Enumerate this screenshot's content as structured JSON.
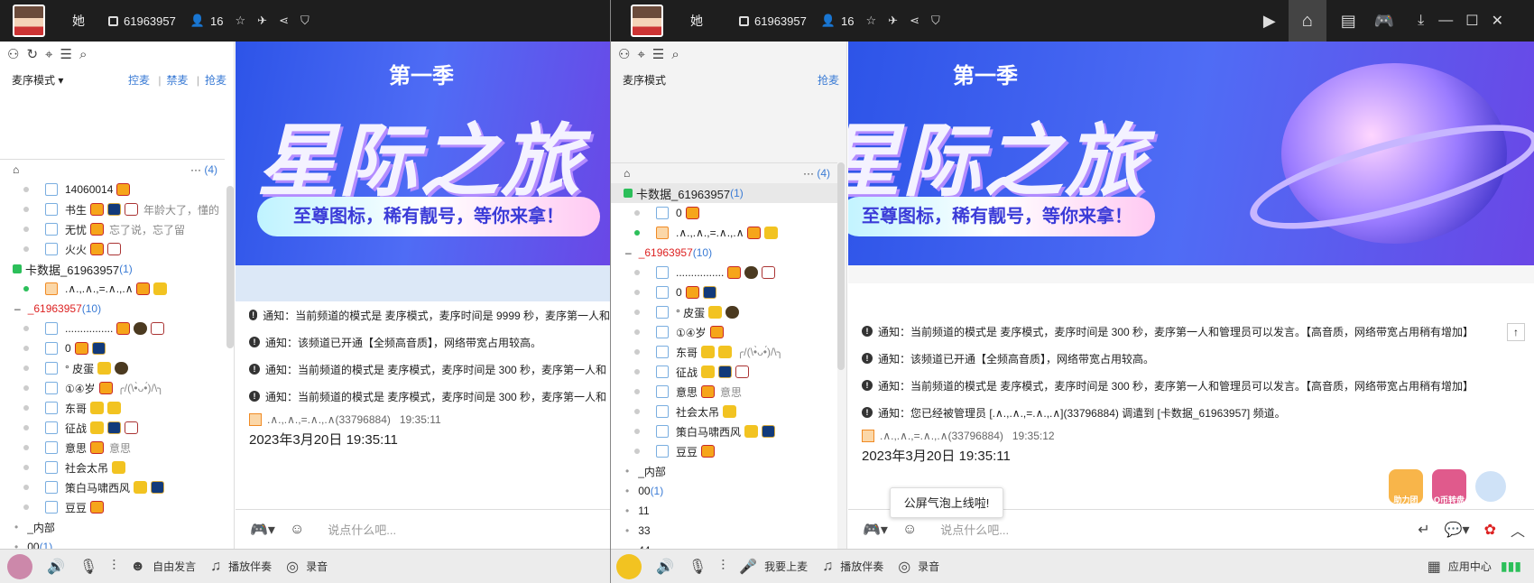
{
  "left": {
    "top": {
      "nick": "她",
      "id": "61963957",
      "count": "16"
    },
    "mode": "麦序模式",
    "mode_links": [
      "控麦",
      "禁麦",
      "抢麦"
    ],
    "ellipsis": "···",
    "count_suffix": "(4)",
    "tree": [
      {
        "kind": "user",
        "name": "14060014",
        "badges": [
          "crown"
        ]
      },
      {
        "kind": "user",
        "name": "书生",
        "badges": [
          "crown",
          "lol",
          "yz"
        ],
        "tail": "年龄大了，懂的"
      },
      {
        "kind": "user",
        "name": "无忧",
        "badges": [
          "crown"
        ],
        "tail": "忘了说，忘了留"
      },
      {
        "kind": "user",
        "name": "火火",
        "badges": [
          "crown",
          "yz"
        ]
      },
      {
        "kind": "channel",
        "name": "卡数据_61963957",
        "count": "(1)"
      },
      {
        "kind": "user",
        "online": true,
        "name": ".∧.,.∧.,=.∧.,.∧",
        "badges": [
          "crown",
          "gold"
        ],
        "orange": true
      },
      {
        "kind": "subchannel",
        "name": "_61963957",
        "count": "(10)"
      },
      {
        "kind": "user",
        "name": "................",
        "badges": [
          "crown",
          "w",
          "yz"
        ]
      },
      {
        "kind": "user",
        "name": "0",
        "badges": [
          "crown",
          "lol"
        ]
      },
      {
        "kind": "user",
        "name": "° 皮蛋",
        "badges": [
          "gold",
          "w"
        ]
      },
      {
        "kind": "user",
        "name": "①④岁",
        "badges": [
          "crown"
        ],
        "tail": "╭/(\\•̀ᴗ•́)/\\╮"
      },
      {
        "kind": "user",
        "name": "东哥",
        "badges": [
          "gold",
          "gold"
        ]
      },
      {
        "kind": "user",
        "name": "征战",
        "badges": [
          "gold",
          "lol",
          "yz"
        ]
      },
      {
        "kind": "user",
        "name": "意思",
        "badges": [
          "crown"
        ],
        "tail": "意思"
      },
      {
        "kind": "user",
        "name": "社会太吊",
        "badges": [
          "gold"
        ]
      },
      {
        "kind": "user",
        "name": "策白马啸西风",
        "badges": [
          "gold",
          "lol"
        ]
      },
      {
        "kind": "user",
        "name": "豆豆",
        "badges": [
          "crown"
        ]
      },
      {
        "kind": "folder",
        "name": "_内部"
      },
      {
        "kind": "folder",
        "name": "00",
        "count": "(1)"
      }
    ],
    "banner": {
      "season": "第一季",
      "title": "星际之旅",
      "sub": "至尊图标，稀有靓号，等你来拿！"
    },
    "messages": [
      "通知：当前频道的模式是 麦序模式，麦序时间是 9999 秒，麦序第一人和",
      "通知：该频道已开通【全频高音质】，网络带宽占用较高。",
      "通知：当前频道的模式是 麦序模式，麦序时间是 300 秒，麦序第一人和",
      "通知：当前频道的模式是 麦序模式，麦序时间是 300 秒，麦序第一人和"
    ],
    "sender": ".∧.,.∧.,=.∧.,.∧(33796884)",
    "sender_time": "19:35:11",
    "stamp": "2023年3月20日  19:35:11",
    "placeholder": "说点什么吧...",
    "bottom": [
      "自由发言",
      "播放伴奏",
      "录音"
    ]
  },
  "right": {
    "top": {
      "nick": "她",
      "id": "61963957",
      "count": "16"
    },
    "mode": "麦序模式",
    "mode_link": "抢麦",
    "ellipsis": "···",
    "count_suffix": "(4)",
    "tree": [
      {
        "kind": "channel",
        "name": "卡数据_61963957",
        "count": "(1)"
      },
      {
        "kind": "user",
        "name": "0",
        "badges": [
          "crown"
        ]
      },
      {
        "kind": "user",
        "online": true,
        "name": ".∧.,.∧.,=.∧.,.∧",
        "badges": [
          "crown",
          "gold"
        ],
        "orange": true
      },
      {
        "kind": "subchannel",
        "name": "_61963957",
        "count": "(10)"
      },
      {
        "kind": "user",
        "name": "................",
        "badges": [
          "crown",
          "w",
          "yz"
        ]
      },
      {
        "kind": "user",
        "name": "0",
        "badges": [
          "crown",
          "lol"
        ]
      },
      {
        "kind": "user",
        "name": "° 皮蛋",
        "badges": [
          "gold",
          "w"
        ]
      },
      {
        "kind": "user",
        "name": "①④岁",
        "badges": [
          "crown"
        ]
      },
      {
        "kind": "user",
        "name": "东哥",
        "badges": [
          "gold",
          "gold"
        ],
        "tail": "╭/(\\•̀ᴗ•́)/\\╮"
      },
      {
        "kind": "user",
        "name": "征战",
        "badges": [
          "gold",
          "lol",
          "yz"
        ]
      },
      {
        "kind": "user",
        "name": "意思",
        "badges": [
          "crown"
        ],
        "tail": "意思"
      },
      {
        "kind": "user",
        "name": "社会太吊",
        "badges": [
          "gold"
        ]
      },
      {
        "kind": "user",
        "name": "策白马啸西风",
        "badges": [
          "gold",
          "lol"
        ]
      },
      {
        "kind": "user",
        "name": "豆豆",
        "badges": [
          "crown"
        ]
      },
      {
        "kind": "folder",
        "name": "_内部"
      },
      {
        "kind": "folder",
        "name": "00",
        "count": "(1)"
      },
      {
        "kind": "folder",
        "name": "11"
      },
      {
        "kind": "folder",
        "name": "33"
      },
      {
        "kind": "folder",
        "name": "44"
      }
    ],
    "banner": {
      "season": "第一季",
      "title": "星际之旅",
      "sub": "至尊图标，稀有靓号，等你来拿！"
    },
    "messages": [
      "通知：当前频道的模式是 麦序模式，麦序时间是 300 秒，麦序第一人和管理员可以发言。【高音质，网络带宽占用稍有增加】",
      "通知：该频道已开通【全频高音质】，网络带宽占用较高。",
      "通知：当前频道的模式是 麦序模式，麦序时间是 300 秒，麦序第一人和管理员可以发言。【高音质，网络带宽占用稍有增加】",
      "通知：您已经被管理员 [.∧.,.∧.,=.∧.,.∧](33796884) 调遣到 [卡数据_61963957] 频道。"
    ],
    "sender": ".∧.,.∧.,=.∧.,.∧(33796884)",
    "sender_time": "19:35:12",
    "stamp": "2023年3月20日  19:35:11",
    "toast": "公屏气泡上线啦!",
    "placeholder": "说点什么吧...",
    "bottom": [
      "我要上麦",
      "播放伴奏",
      "录音"
    ],
    "app_center": "应用中心",
    "bubble_labels": [
      "助力团",
      "Q币转盘"
    ]
  }
}
